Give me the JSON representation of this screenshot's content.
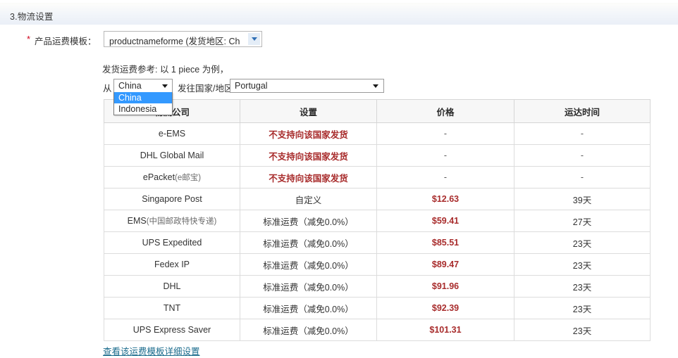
{
  "section": {
    "title": "3.物流设置"
  },
  "shipping_template": {
    "required_mark": "*",
    "label": "产品运费模板：",
    "selected": "productnameforme (发货地区: China",
    "arrow_icon": "chevron-down-icon"
  },
  "reference": {
    "text": "发货运费参考: 以 1 piece 为例，",
    "quantity": "1 piece"
  },
  "origin": {
    "label": "从",
    "selected": "China",
    "options": [
      "China",
      "Indonesia"
    ],
    "highlighted_index": 0,
    "arrow_icon": "chevron-down-icon"
  },
  "destination": {
    "label": "发往国家/地区",
    "selected": "Portugal",
    "arrow_icon": "chevron-down-icon"
  },
  "table": {
    "headers": [
      "物流公司",
      "设置",
      "价格",
      "运达时间"
    ],
    "rows": [
      {
        "carrier": "e-EMS",
        "carrier_sub": "",
        "setting": "不支持向该国家发货",
        "setting_state": "unsupported",
        "price": "-",
        "time": "-"
      },
      {
        "carrier": "DHL Global Mail",
        "carrier_sub": "",
        "setting": "不支持向该国家发货",
        "setting_state": "unsupported",
        "price": "-",
        "time": "-"
      },
      {
        "carrier": "ePacket",
        "carrier_sub": "(e邮宝)",
        "setting": "不支持向该国家发货",
        "setting_state": "unsupported",
        "price": "-",
        "time": "-"
      },
      {
        "carrier": "Singapore Post",
        "carrier_sub": "",
        "setting": "自定义",
        "setting_state": "custom",
        "price": "$12.63",
        "time": "39天"
      },
      {
        "carrier": "EMS",
        "carrier_sub": "(中国邮政特快专递)",
        "setting": "标准运费（减免0.0%）",
        "setting_state": "standard",
        "price": "$59.41",
        "time": "27天"
      },
      {
        "carrier": "UPS Expedited",
        "carrier_sub": "",
        "setting": "标准运费（减免0.0%）",
        "setting_state": "standard",
        "price": "$85.51",
        "time": "23天"
      },
      {
        "carrier": "Fedex IP",
        "carrier_sub": "",
        "setting": "标准运费（减免0.0%）",
        "setting_state": "standard",
        "price": "$89.47",
        "time": "23天"
      },
      {
        "carrier": "DHL",
        "carrier_sub": "",
        "setting": "标准运费（减免0.0%）",
        "setting_state": "standard",
        "price": "$91.96",
        "time": "23天"
      },
      {
        "carrier": "TNT",
        "carrier_sub": "",
        "setting": "标准运费（减免0.0%）",
        "setting_state": "standard",
        "price": "$92.39",
        "time": "23天"
      },
      {
        "carrier": "UPS Express Saver",
        "carrier_sub": "",
        "setting": "标准运费（减免0.0%）",
        "setting_state": "standard",
        "price": "$101.31",
        "time": "23天"
      }
    ]
  },
  "detail_link": {
    "label": "查看该运费模板详细设置"
  },
  "colors": {
    "price_red": "#a82c2c",
    "link_teal": "#1a6b8c",
    "highlight_blue": "#3399ff",
    "required_red": "#d0021b"
  }
}
